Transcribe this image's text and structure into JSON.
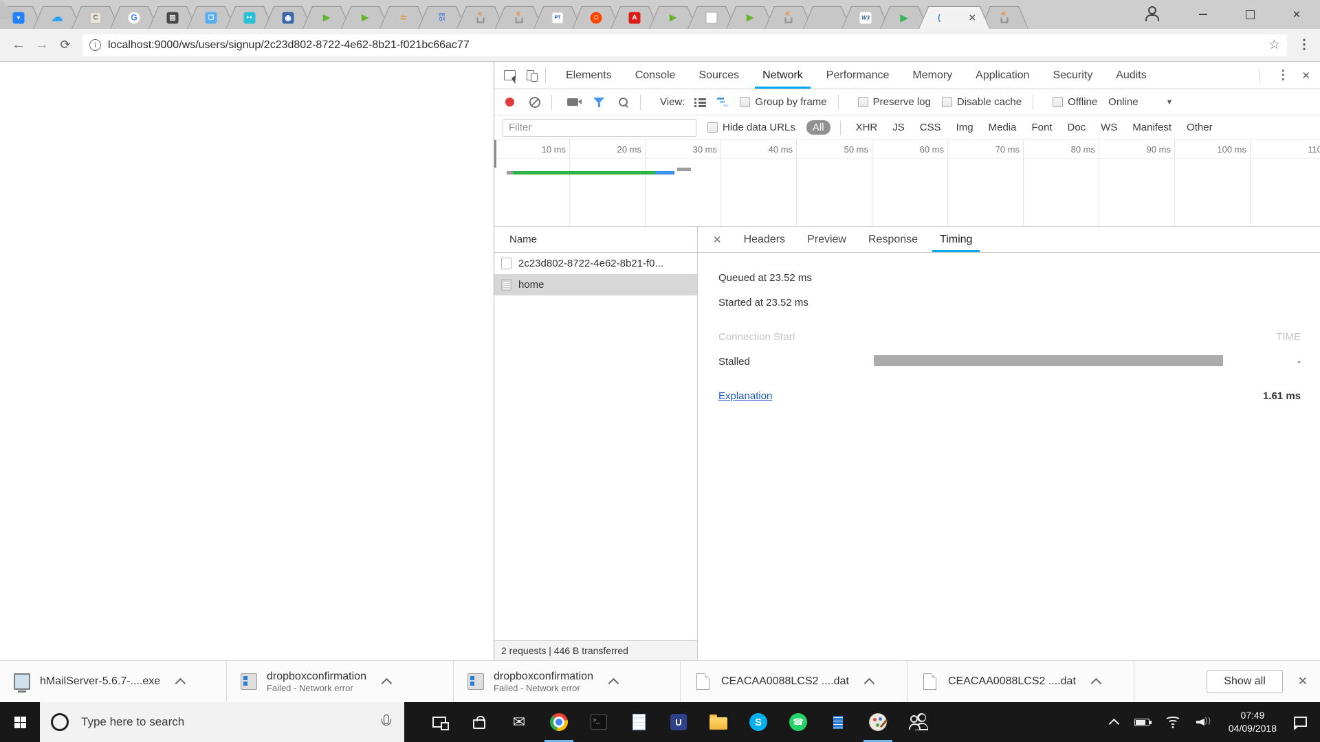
{
  "browser": {
    "tabs": [
      {
        "icon": "bitbucket",
        "state": "normal"
      },
      {
        "icon": "cloud",
        "state": "normal"
      },
      {
        "icon": "c-chip",
        "state": "normal"
      },
      {
        "icon": "google",
        "state": "normal"
      },
      {
        "icon": "journal",
        "state": "normal"
      },
      {
        "icon": "blue-window",
        "state": "normal"
      },
      {
        "icon": "teal-dots",
        "state": "normal"
      },
      {
        "icon": "penguin",
        "state": "normal"
      },
      {
        "icon": "green-play",
        "state": "normal"
      },
      {
        "icon": "green-play",
        "state": "normal"
      },
      {
        "icon": "orange-swoosh",
        "state": "normal"
      },
      {
        "icon": "rxjs",
        "state": "normal"
      },
      {
        "icon": "stackoverflow",
        "state": "normal"
      },
      {
        "icon": "stackoverflow",
        "state": "normal"
      },
      {
        "icon": "pt",
        "state": "normal"
      },
      {
        "icon": "reddit",
        "state": "normal"
      },
      {
        "icon": "angular",
        "state": "normal"
      },
      {
        "icon": "green-play",
        "state": "normal"
      },
      {
        "icon": "blank-page",
        "state": "normal"
      },
      {
        "icon": "green-play",
        "state": "normal"
      },
      {
        "icon": "stackoverflow",
        "state": "normal"
      },
      {
        "icon": "empty",
        "state": "normal"
      },
      {
        "icon": "w3schools",
        "state": "normal"
      },
      {
        "icon": "play-triangle",
        "state": "normal"
      },
      {
        "icon": "localhost",
        "state": "active"
      },
      {
        "icon": "stackoverflow",
        "state": "normal"
      }
    ],
    "address": {
      "url": "localhost:9000/ws/users/signup/2c23d802-8722-4e62-8b21-f021bc66ac77"
    }
  },
  "devtools": {
    "tabs": [
      {
        "label": "Elements",
        "state": "normal"
      },
      {
        "label": "Console",
        "state": "normal"
      },
      {
        "label": "Sources",
        "state": "normal"
      },
      {
        "label": "Network",
        "state": "active"
      },
      {
        "label": "Performance",
        "state": "normal"
      },
      {
        "label": "Memory",
        "state": "normal"
      },
      {
        "label": "Application",
        "state": "normal"
      },
      {
        "label": "Security",
        "state": "normal"
      },
      {
        "label": "Audits",
        "state": "normal"
      }
    ],
    "toolbar": {
      "view_label": "View:",
      "group_by_frame": "Group by frame",
      "preserve_log": "Preserve log",
      "disable_cache": "Disable cache",
      "offline": "Offline",
      "online": "Online"
    },
    "filter": {
      "placeholder": "Filter",
      "hide_data_urls": "Hide data URLs",
      "all_pill": "All",
      "types": [
        "XHR",
        "JS",
        "CSS",
        "Img",
        "Media",
        "Font",
        "Doc",
        "WS",
        "Manifest",
        "Other"
      ]
    },
    "timeline": {
      "ticks": [
        "10 ms",
        "20 ms",
        "30 ms",
        "40 ms",
        "50 ms",
        "60 ms",
        "70 ms",
        "80 ms",
        "90 ms",
        "100 ms",
        "110"
      ],
      "overview_bars": {
        "stub_gray_ms": [
          0.5,
          1.5
        ],
        "green_ms": [
          1.5,
          21.5
        ],
        "blue_ms": [
          21.5,
          24.0
        ],
        "upper_gray_ms": [
          24.5,
          26.5
        ]
      }
    },
    "requests": {
      "header": "Name",
      "rows": [
        {
          "icon": "blank-file",
          "label": "2c23d802-8722-4e62-8b21-f0...",
          "state": "normal"
        },
        {
          "icon": "document",
          "label": "home",
          "state": "selected"
        }
      ],
      "summary": "2 requests  |  446 B transferred"
    },
    "details": {
      "tabs": [
        {
          "label": "Headers",
          "state": "normal"
        },
        {
          "label": "Preview",
          "state": "normal"
        },
        {
          "label": "Response",
          "state": "normal"
        },
        {
          "label": "Timing",
          "state": "active"
        }
      ],
      "timing": {
        "queued": "Queued at 23.52 ms",
        "started": "Started at 23.52 ms",
        "section_label": "Connection Start",
        "time_header": "TIME",
        "row_label": "Stalled",
        "row_value": "-",
        "link": "Explanation",
        "total": "1.61 ms"
      }
    }
  },
  "downloads_bar": {
    "items": [
      {
        "icon": "installer",
        "label": "hMailServer-5.6.7-....exe",
        "sub": ""
      },
      {
        "icon": "msi",
        "label": "dropboxconfirmation",
        "sub": "Failed - Network error"
      },
      {
        "icon": "msi",
        "label": "dropboxconfirmation",
        "sub": "Failed - Network error"
      },
      {
        "icon": "file",
        "label": "CEACAA0088LCS2 ....dat",
        "sub": ""
      },
      {
        "icon": "file",
        "label": "CEACAA0088LCS2 ....dat",
        "sub": ""
      }
    ],
    "show_all": "Show all"
  },
  "taskbar": {
    "search_placeholder": "Type here to search",
    "apps": [
      {
        "icon": "task-view",
        "state": "normal"
      },
      {
        "icon": "store",
        "state": "normal"
      },
      {
        "icon": "mail",
        "state": "normal"
      },
      {
        "icon": "chrome",
        "state": "running"
      },
      {
        "icon": "cmd",
        "state": "normal"
      },
      {
        "icon": "notepad",
        "state": "normal"
      },
      {
        "icon": "u-editor",
        "state": "normal"
      },
      {
        "icon": "file-explorer",
        "state": "normal"
      },
      {
        "icon": "skype",
        "state": "normal"
      },
      {
        "icon": "whatsapp",
        "state": "normal"
      },
      {
        "icon": "blue-doc",
        "state": "normal"
      },
      {
        "icon": "paint",
        "state": "running"
      },
      {
        "icon": "people",
        "state": "normal"
      }
    ],
    "clock": {
      "time": "07:49",
      "date": "04/09/2018"
    }
  },
  "colors": {
    "devtools_accent": "#03a9f4",
    "overview_green": "#2fb344",
    "overview_blue": "#3c92ea",
    "stalled_gray": "#ababab",
    "record_red": "#df3a3a",
    "link_blue": "#1a56c4"
  }
}
